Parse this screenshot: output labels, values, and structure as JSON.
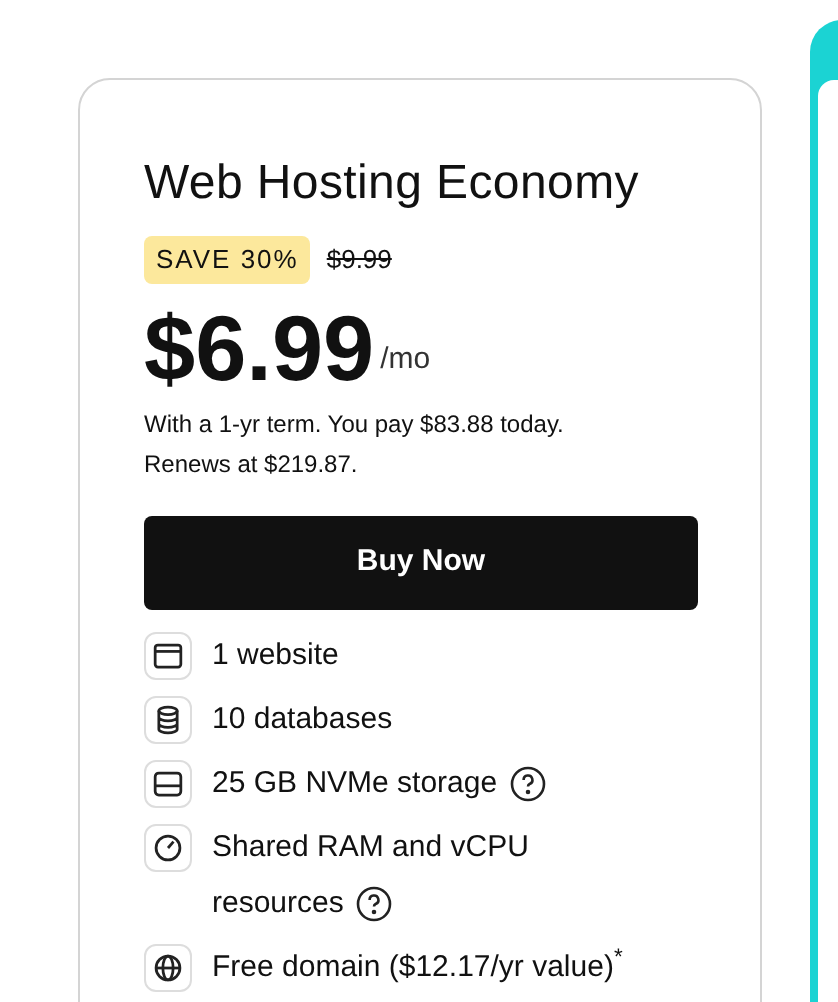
{
  "plan": {
    "title": "Web Hosting Economy",
    "badge": "SAVE 30%",
    "old_price": "$9.99",
    "price": "$6.99",
    "period": "/mo",
    "terms": [
      "With a 1-yr term. You pay $83.88 today.",
      "Renews at $219.87."
    ],
    "button": "Buy Now",
    "features": [
      {
        "kind": "window",
        "text": "1 website",
        "help": false
      },
      {
        "kind": "database",
        "text": "10 databases",
        "help": false
      },
      {
        "kind": "drive",
        "text": "25 GB NVMe storage",
        "help": true
      },
      {
        "kind": "gauge",
        "text": "Shared RAM and vCPU resources",
        "help": true
      },
      {
        "kind": "globe",
        "text": "Free domain ($12.17/yr value)$^{*}$",
        "help": false
      }
    ]
  }
}
